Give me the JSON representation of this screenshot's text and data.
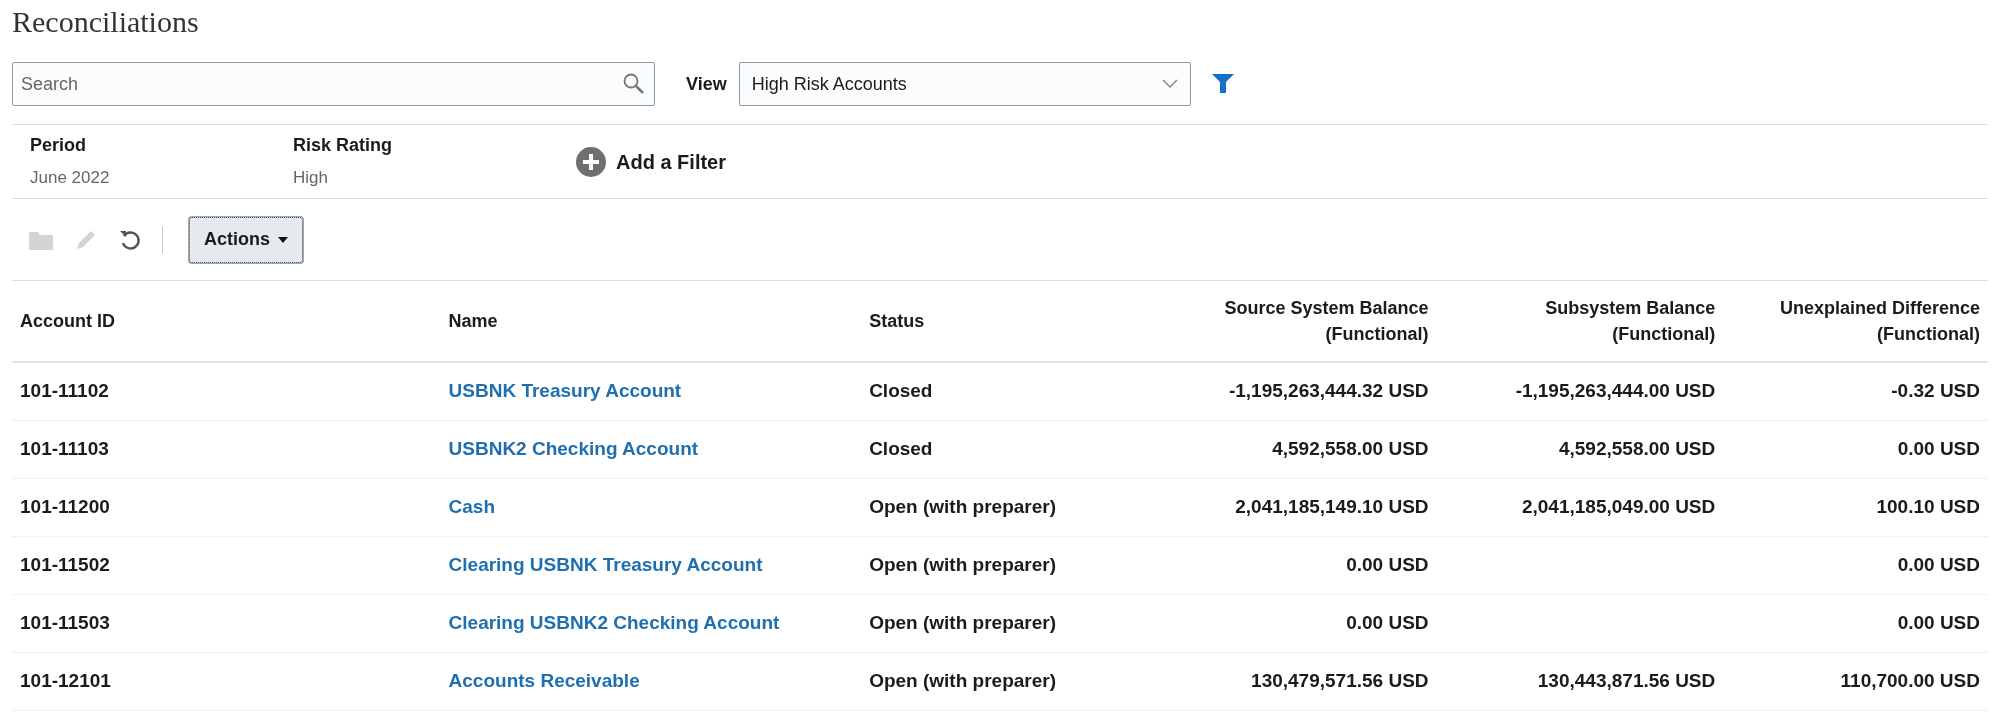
{
  "title": "Reconciliations",
  "search": {
    "placeholder": "Search"
  },
  "view": {
    "label": "View",
    "value": "High Risk Accounts"
  },
  "filters": [
    {
      "label": "Period",
      "value": "June 2022"
    },
    {
      "label": "Risk Rating",
      "value": "High"
    }
  ],
  "add_filter": "Add a Filter",
  "toolbar": {
    "icons": [
      {
        "kind": "folder",
        "disabled": true
      },
      {
        "kind": "pencil",
        "disabled": true
      },
      {
        "kind": "refresh",
        "disabled": false
      }
    ],
    "actions": "Actions"
  },
  "table": {
    "columns": [
      "Account ID",
      "Name",
      "Status",
      "Source System Balance (Functional)",
      "Subsystem Balance (Functional)",
      "Unexplained Difference (Functional)"
    ],
    "rows": [
      [
        "101-11102",
        "USBNK Treasury Account",
        "Closed",
        "-1,195,263,444.32 USD",
        "-1,195,263,444.00 USD",
        "-0.32 USD"
      ],
      [
        "101-11103",
        "USBNK2 Checking Account",
        "Closed",
        "4,592,558.00 USD",
        "4,592,558.00 USD",
        "0.00 USD"
      ],
      [
        "101-11200",
        "Cash",
        "Open (with preparer)",
        "2,041,185,149.10 USD",
        "2,041,185,049.00 USD",
        "100.10 USD"
      ],
      [
        "101-11502",
        "Clearing USBNK Treasury Account",
        "Open (with preparer)",
        "0.00 USD",
        null,
        "0.00 USD"
      ],
      [
        "101-11503",
        "Clearing USBNK2 Checking Account",
        "Open (with preparer)",
        "0.00 USD",
        null,
        "0.00 USD"
      ],
      [
        "101-12101",
        "Accounts Receivable",
        "Open (with preparer)",
        "130,479,571.56 USD",
        "130,443,871.56 USD",
        "110,700.00 USD"
      ]
    ]
  }
}
